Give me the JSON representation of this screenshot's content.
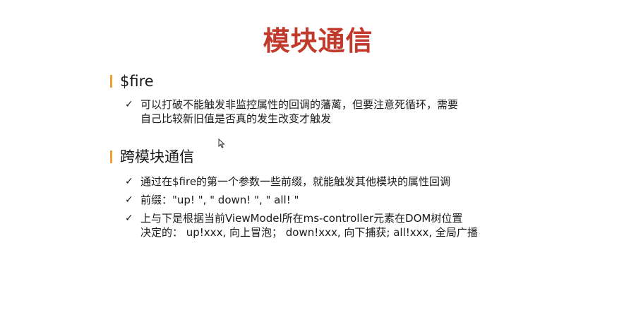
{
  "colors": {
    "title": "#c0392b",
    "accent": "#f0a030",
    "text": "#1a1a1a"
  },
  "slide": {
    "title": "模块通信",
    "sections": [
      {
        "heading": "$fire",
        "bullets": [
          "可以打破不能触发非监控属性的回调的藩蓠，但要注意死循环，需要\n自己比较新旧值是否真的发生改变才触发"
        ]
      },
      {
        "heading": "跨模块通信",
        "bullets": [
          "通过在$fire的第一个参数一些前缀，就能触发其他模块的属性回调",
          "前缀：\"up! \", \" down! \", \" all! \"",
          "上与下是根据当前ViewModel所在ms-controller元素在DOM树位置\n决定的： up!xxx, 向上冒泡； down!xxx, 向下捕获; all!xxx, 全局广播"
        ]
      }
    ]
  },
  "icons": {
    "bullet": "check-icon",
    "check_glyph": "✓",
    "cursor": "mouse-pointer-icon"
  }
}
